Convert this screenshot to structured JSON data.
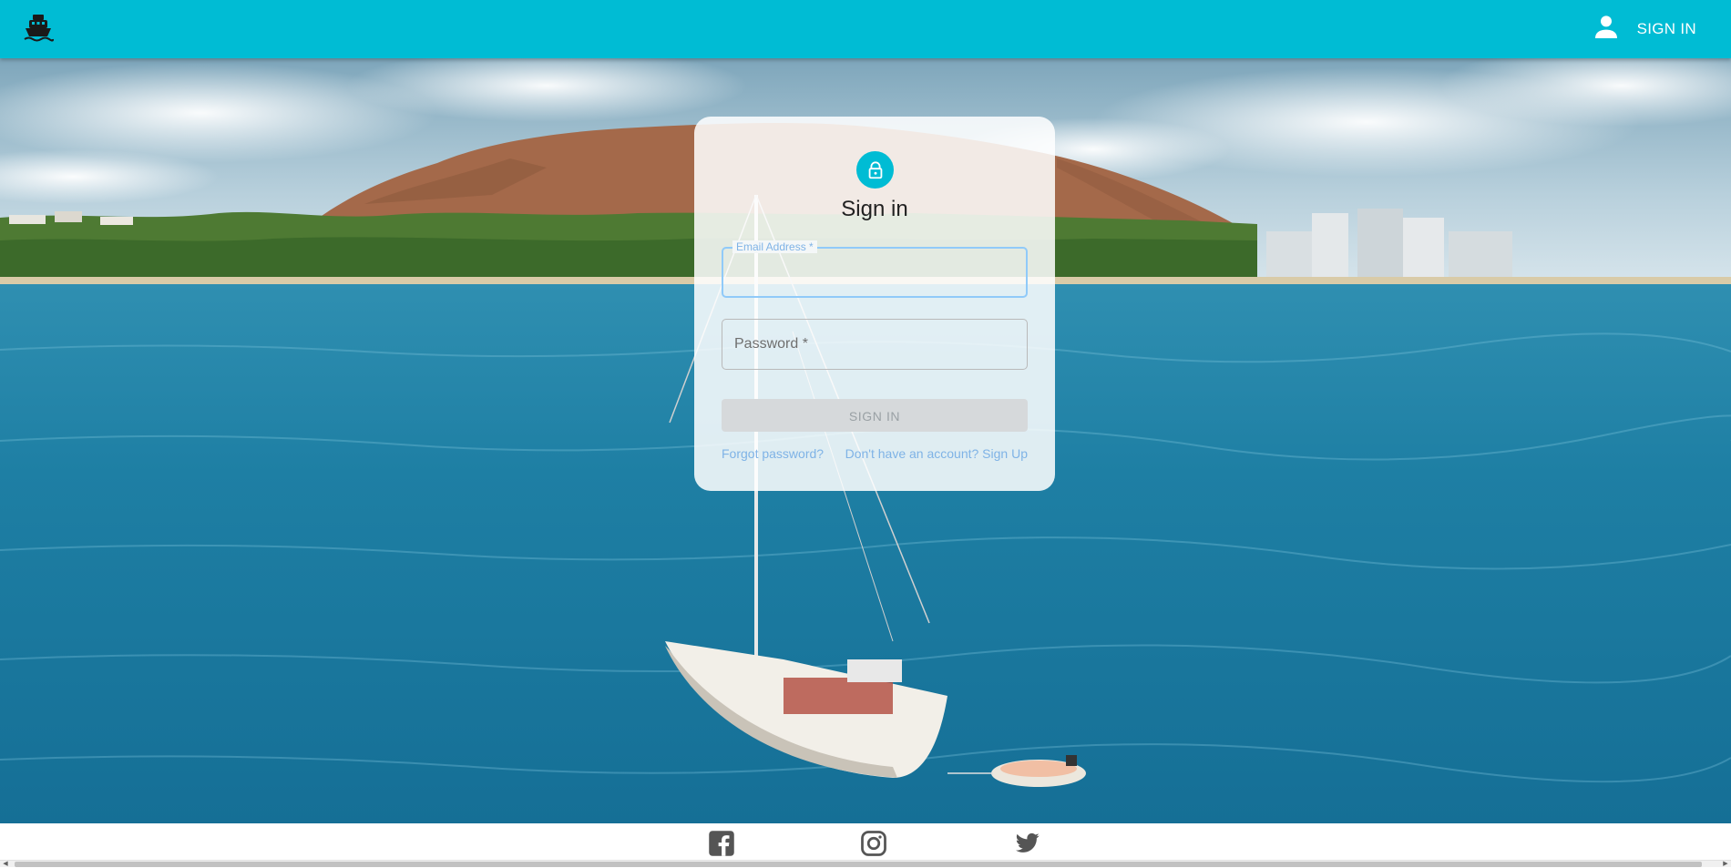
{
  "appbar": {
    "logo_icon": "ship-icon",
    "account_icon": "person-icon",
    "signin_label": "SIGN IN",
    "color": "#00bcd4"
  },
  "card": {
    "lock_icon": "lock-icon",
    "title": "Sign in",
    "email": {
      "label": "Email Address *",
      "value": ""
    },
    "password": {
      "placeholder": "Password *",
      "value": ""
    },
    "submit_label": "SIGN IN",
    "forgot_link": "Forgot password?",
    "signup_link": "Don't have an account? Sign Up"
  },
  "footer": {
    "social": [
      {
        "icon": "facebook-icon"
      },
      {
        "icon": "instagram-icon"
      },
      {
        "icon": "twitter-icon"
      }
    ]
  }
}
